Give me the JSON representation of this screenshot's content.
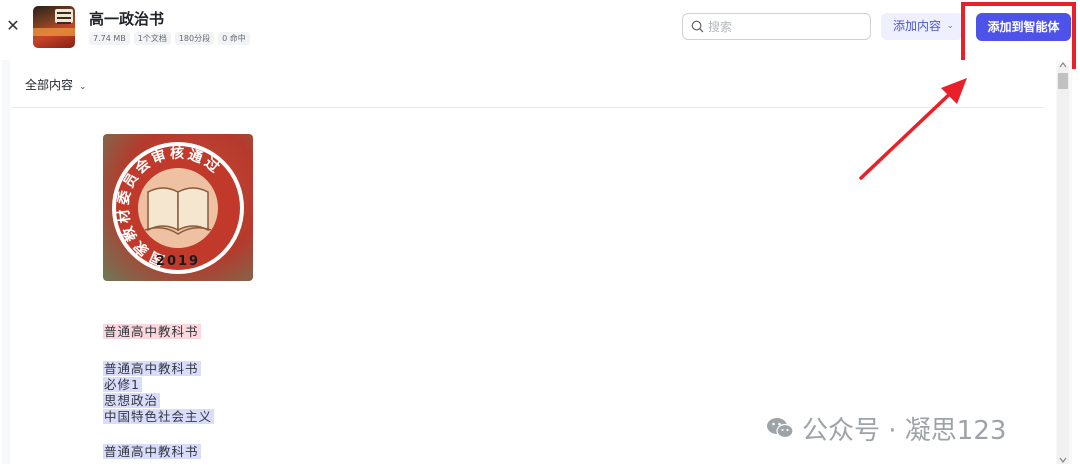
{
  "header": {
    "title": "高一政治书",
    "badges": [
      "7.74 MB",
      "1个文档",
      "180分段",
      "0 命中"
    ],
    "search": {
      "placeholder": "搜索",
      "value": ""
    },
    "add_content_label": "添加内容",
    "add_to_agent_label": "添加到智能体"
  },
  "toolbar": {
    "filter_label": "全部内容"
  },
  "emblem": {
    "ring_text": "国家教材委员会审核通过",
    "year": "2019",
    "colors": {
      "ring": "#c0392b",
      "inner": "#efc1a3",
      "book": "#f4e6cf"
    }
  },
  "document": {
    "lines_block1": [
      "普通高中教科书"
    ],
    "lines_block2": [
      "普通高中教科书",
      "必修1",
      "思想政治",
      "中国特色社会主义"
    ],
    "lines_block3": [
      "普通高中教科书"
    ]
  },
  "watermark": {
    "text": "公众号 · 凝思123"
  },
  "colors": {
    "primary": "#4d53e8",
    "annotation": "#e8202a",
    "pink_highlight": "#fbd7de",
    "blue_highlight": "#d9dcfb"
  },
  "icons": {
    "close": "close-icon",
    "search": "search-icon",
    "dropdown": "chevron-down-icon"
  }
}
